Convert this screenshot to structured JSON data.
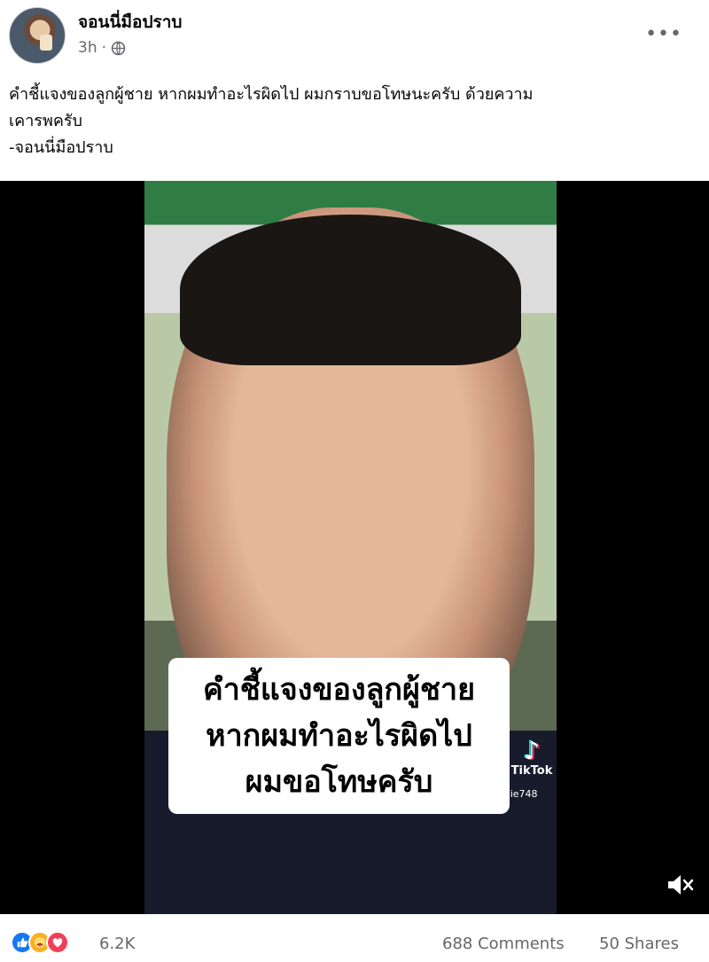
{
  "post": {
    "author": "จอนนี่มือปราบ",
    "time": "3h",
    "separator": "·",
    "privacy_icon": "globe-icon",
    "more_label": "•••",
    "caption": [
      "คำชี้แจงของลูกผู้ชาย หากผมทำอะไรผิดไป ผมกราบขอโทษนะครับ ด้วยความ",
      "เคารพครับ",
      "-จอนนี่มือปราบ"
    ]
  },
  "video": {
    "subtitle": [
      "คำชี้แจงของลูกผู้ชาย",
      "หากผมทำอะไรผิดไป",
      "ผมขอโทษครับ"
    ],
    "watermark_logo": "TikTok",
    "watermark_user": "@jonnie748",
    "mute_icon": "speaker-muted-icon"
  },
  "footer": {
    "reaction_icons": [
      "like-icon",
      "care-icon",
      "love-icon"
    ],
    "reaction_count": "6.2K",
    "comments": "688 Comments",
    "shares": "50 Shares"
  },
  "colors": {
    "meta_gray": "#65676b",
    "like_blue": "#1877f2",
    "care_yellow": "#f7b125",
    "love_red": "#f33e58",
    "tiktok_cyan": "#25f4ee",
    "tiktok_pink": "#fe2c55"
  }
}
